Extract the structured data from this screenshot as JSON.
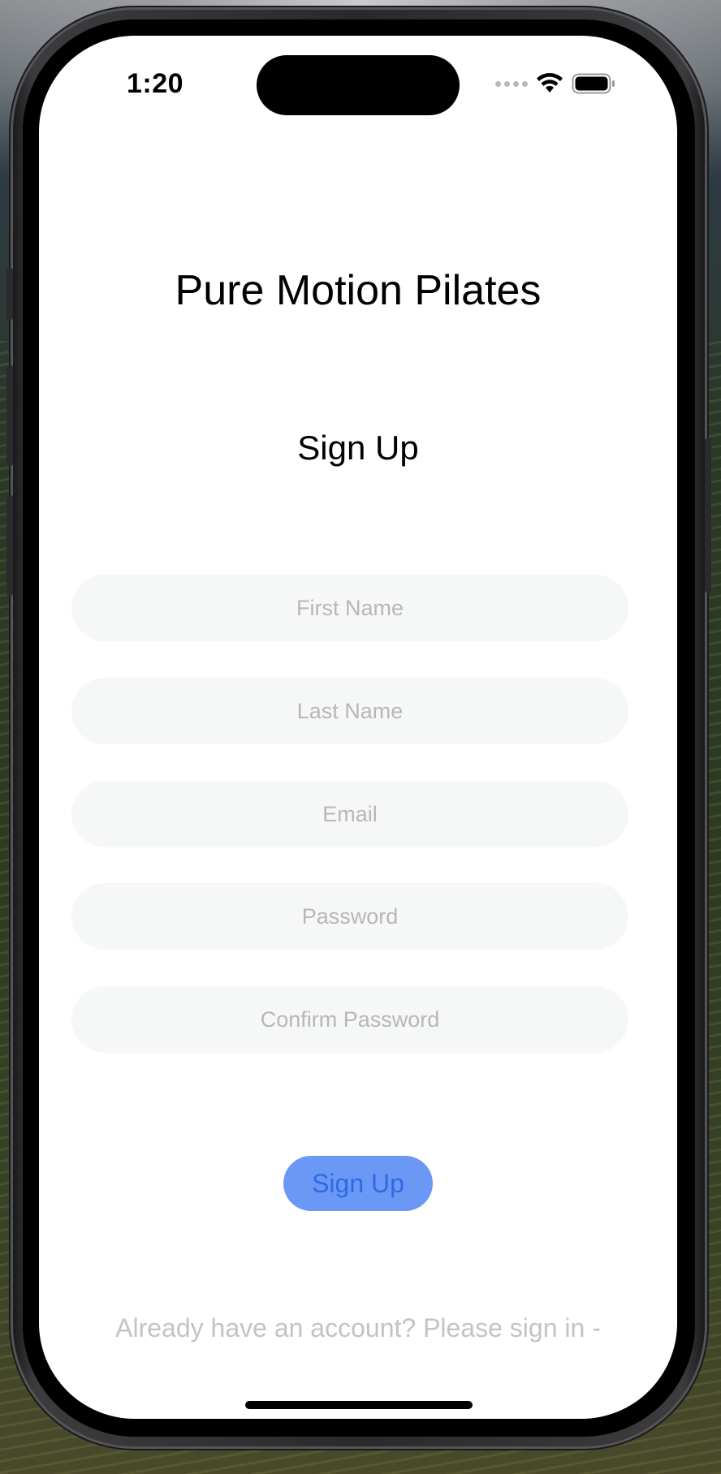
{
  "status_bar": {
    "time": "1:20"
  },
  "app": {
    "title": "Pure Motion Pilates"
  },
  "page": {
    "title": "Sign Up"
  },
  "form": {
    "first_name_placeholder": "First Name",
    "last_name_placeholder": "Last Name",
    "email_placeholder": "Email",
    "password_placeholder": "Password",
    "confirm_password_placeholder": "Confirm Password",
    "submit_label": "Sign Up"
  },
  "footer": {
    "signin_text": "Already have an account? Please sign in -"
  },
  "colors": {
    "button_bg": "#6b98f4",
    "button_text": "#2f6ae4",
    "field_bg": "#f6f7f7",
    "placeholder": "#b7b7b9",
    "link_text": "#c3c3c5"
  },
  "icons": {
    "signal": "cellular-signal-dots-icon",
    "wifi": "wifi-icon",
    "battery": "battery-icon"
  }
}
